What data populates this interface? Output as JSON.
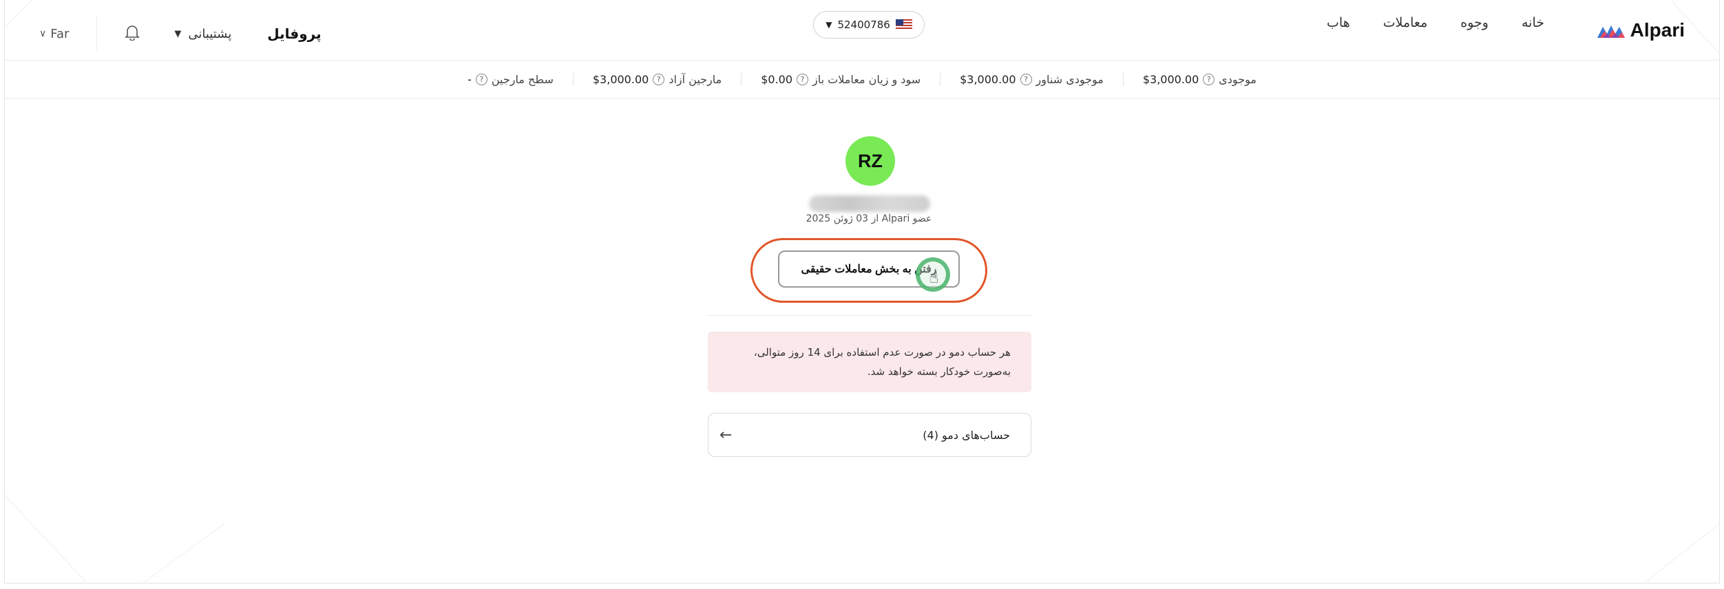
{
  "header": {
    "brand": "Alpari",
    "nav": [
      "خانه",
      "وجوه",
      "معاملات",
      "هاب"
    ],
    "account_number": "52400786",
    "language": "Far",
    "support": "پشتیبانی",
    "profile": "پروفایل"
  },
  "stats": [
    {
      "label": "موجودی",
      "value": "$3,000.00"
    },
    {
      "label": "موجودی شناور",
      "value": "$3,000.00"
    },
    {
      "label": "سود و زیان معاملات باز",
      "value": "$0.00"
    },
    {
      "label": "مارجین آزاد",
      "value": "$3,000.00"
    },
    {
      "label": "سطح مارجین",
      "value": "-"
    }
  ],
  "profile": {
    "initials": "RZ",
    "member_since": "عضو Alpari از 03 ژوئن 2025"
  },
  "cta": {
    "label": "رفتن به بخش معاملات حقیقی"
  },
  "notice": {
    "line1": "هر حساب دمو در صورت عدم استفاده برای 14 روز متوالی،",
    "line2": "به‌صورت خودکار بسته خواهد شد."
  },
  "demo_accounts": {
    "label": "حساب‌های دمو (4)"
  },
  "colors": {
    "avatar": "#79ea56",
    "highlight_ring": "#e2562a",
    "notice_bg": "#fbe8ea"
  }
}
